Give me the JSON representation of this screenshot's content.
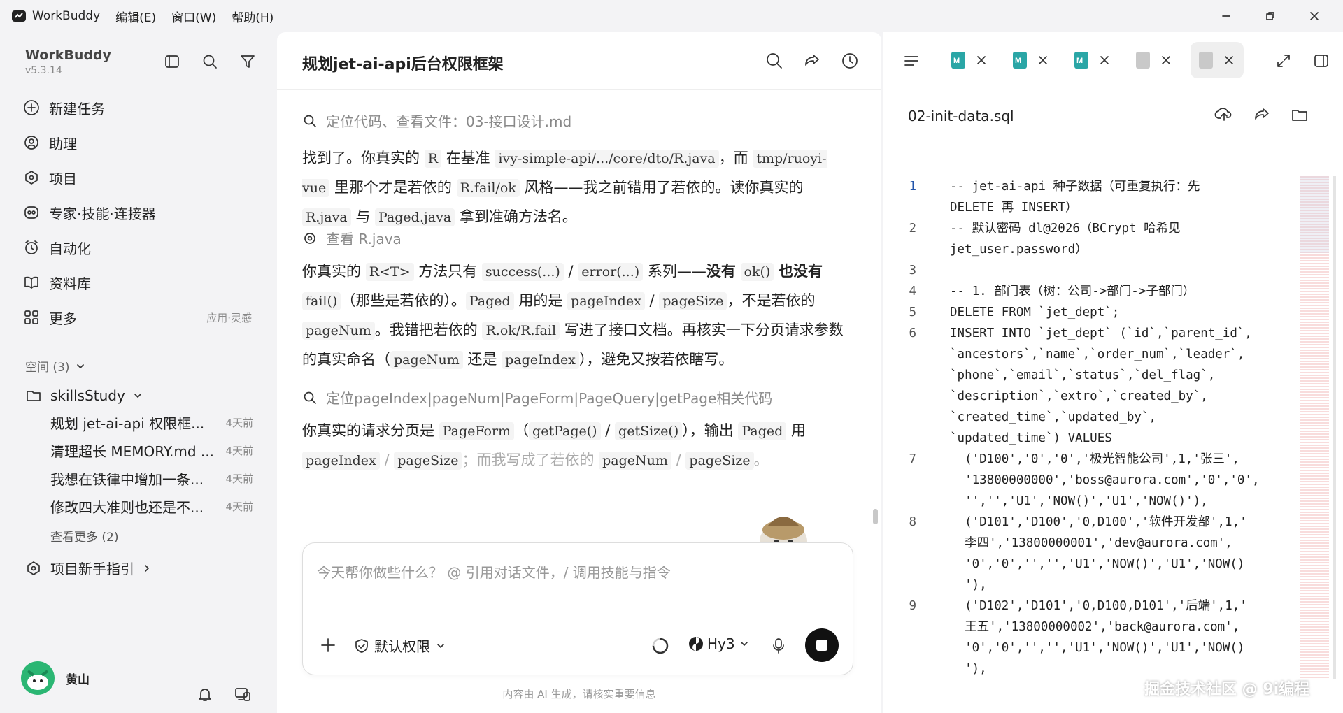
{
  "titlebar": {
    "app_name": "WorkBuddy",
    "menus": [
      "编辑(E)",
      "窗口(W)",
      "帮助(H)"
    ]
  },
  "sidebar": {
    "name": "WorkBuddy",
    "version": "v5.3.14",
    "nav": [
      {
        "label": "新建任务",
        "icon": "new-task-icon"
      },
      {
        "label": "助理",
        "icon": "assistant-icon"
      },
      {
        "label": "项目",
        "icon": "project-icon"
      },
      {
        "label": "专家·技能·连接器",
        "icon": "expert-icon"
      },
      {
        "label": "自动化",
        "icon": "alarm-icon"
      },
      {
        "label": "资料库",
        "icon": "book-icon"
      },
      {
        "label": "更多",
        "icon": "grid-icon",
        "extra": "应用·灵感"
      }
    ],
    "space_label": "空间 (3)",
    "project_name": "skillsStudy",
    "tasks": [
      {
        "title": "规划 jet-ai-api 权限框...",
        "ago": "4天前"
      },
      {
        "title": "清理超长 MEMORY.md ...",
        "ago": "4天前"
      },
      {
        "title": "我想在铁律中增加一条...",
        "ago": "4天前"
      },
      {
        "title": "修改四大准则也还是不...",
        "ago": "4天前"
      }
    ],
    "see_more": "查看更多 (2)",
    "guide": "项目新手指引",
    "user_name": "黄山"
  },
  "chat": {
    "title": "规划jet-ai-api后台权限框架",
    "step1": "定位代码、查看文件：03-接口设计.md",
    "step2": "查看 R.java",
    "step3": "定位pageIndex|pageNum|PageForm|PageQuery|getPage相关代码",
    "input_placeholder": "今天帮你做些什么？ @ 引用对话文件，/ 调用技能与指令",
    "permission": "默认权限",
    "model": "Hy3",
    "disclaimer": "内容由 AI 生成，请核实重要信息"
  },
  "editor": {
    "filename": "02-init-data.sql",
    "tabs": [
      {
        "type": "md"
      },
      {
        "type": "md"
      },
      {
        "type": "md"
      },
      {
        "type": "file"
      },
      {
        "type": "file",
        "active": true
      }
    ],
    "lines": [
      {
        "n": "1",
        "t": "-- jet-ai-api 种子数据（可重复执行：先\nDELETE 再 INSERT）"
      },
      {
        "n": "2",
        "t": "-- 默认密码 dl@2026（BCrypt 哈希见\njet_user.password）"
      },
      {
        "n": "3",
        "t": ""
      },
      {
        "n": "4",
        "t": "-- 1. 部门表（树：公司->部门->子部门）"
      },
      {
        "n": "5",
        "t": "DELETE FROM `jet_dept`;"
      },
      {
        "n": "6",
        "t": "INSERT INTO `jet_dept` (`id`,`parent_id`,\n`ancestors`,`name`,`order_num`,`leader`,\n`phone`,`email`,`status`,`del_flag`,\n`description`,`extro`,`created_by`,\n`created_time`,`updated_by`,\n`updated_time`) VALUES"
      },
      {
        "n": "7",
        "t": "  ('D100','0','0','极光智能公司',1,'张三',\n  '13800000000','boss@aurora.com','0','0',\n  '','','U1','NOW()','U1','NOW()'),"
      },
      {
        "n": "8",
        "t": "  ('D101','D100','0,D100','软件开发部',1,'\n  李四','13800000001','dev@aurora.com',\n  '0','0','','','U1','NOW()','U1','NOW()\n  '),"
      },
      {
        "n": "9",
        "t": "  ('D102','D101','0,D100,D101','后端',1,'\n  王五','13800000002','back@aurora.com',\n  '0','0','','','U1','NOW()','U1','NOW()\n  '),"
      }
    ]
  },
  "watermark": "掘金技术社区 @ 9i编程"
}
